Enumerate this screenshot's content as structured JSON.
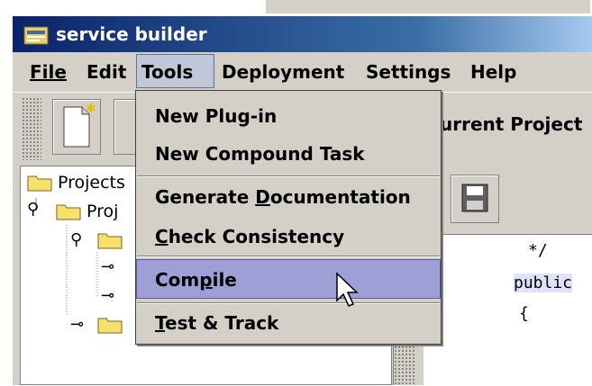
{
  "window": {
    "title": "service builder"
  },
  "menu": [
    {
      "label": "File",
      "mnemonic_index": 0
    },
    {
      "label": "Edit",
      "mnemonic_index": 0
    },
    {
      "label": "Tools",
      "mnemonic_index": 0,
      "active": true
    },
    {
      "label": "Deployment",
      "mnemonic_index": 0
    },
    {
      "label": "Settings",
      "mnemonic_index": 0
    },
    {
      "label": "Help",
      "mnemonic_index": 0
    }
  ],
  "toolbar": {
    "current_project_label": "urrent Project"
  },
  "tree": {
    "root_label": "Projects",
    "child_label": "Proj"
  },
  "code": {
    "line1": "*/",
    "line2": "public",
    "line3": "{"
  },
  "tools_menu": {
    "items": [
      {
        "label": "New Plug-in"
      },
      {
        "label": "New Compound Task"
      },
      {
        "label": "Generate Documentation",
        "mnemonic": "D"
      },
      {
        "label": "Check Consistency",
        "mnemonic": "C"
      },
      {
        "label": "Compile",
        "mnemonic": "p",
        "highlighted": true
      },
      {
        "label": "Test & Track",
        "mnemonic": "T"
      }
    ]
  },
  "colors": {
    "menu_highlight": "#9d9fd6",
    "window_bg": "#d4d0c8",
    "titlebar": "#0a246a"
  }
}
